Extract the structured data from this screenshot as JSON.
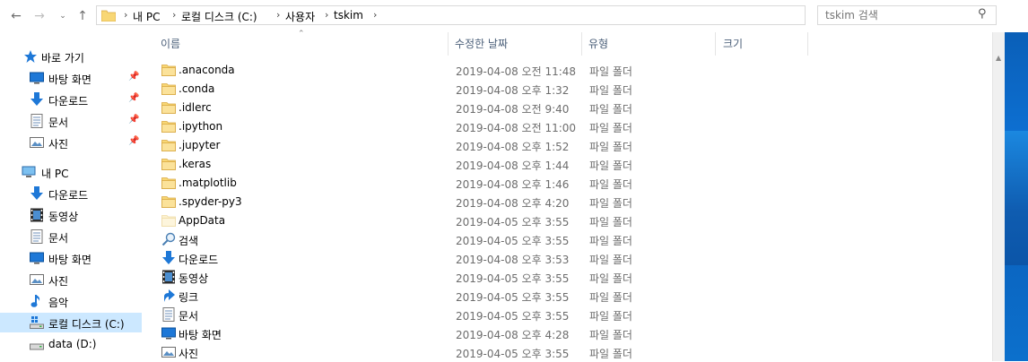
{
  "address": {
    "crumbs": [
      "내 PC",
      "로컬 디스크 (C:)",
      "사용자",
      "tskim"
    ],
    "search_placeholder": "tskim 검색"
  },
  "columns": {
    "name": "이름",
    "date": "수정한 날짜",
    "type": "유형",
    "size": "크기"
  },
  "nav": {
    "quick_access": "바로 가기",
    "quick_items": [
      {
        "label": "바탕 화면",
        "icon": "desktop-icon"
      },
      {
        "label": "다운로드",
        "icon": "download-icon"
      },
      {
        "label": "문서",
        "icon": "document-icon"
      },
      {
        "label": "사진",
        "icon": "picture-icon"
      }
    ],
    "this_pc": "내 PC",
    "pc_items": [
      {
        "label": "다운로드",
        "icon": "download-icon"
      },
      {
        "label": "동영상",
        "icon": "video-icon"
      },
      {
        "label": "문서",
        "icon": "document-icon"
      },
      {
        "label": "바탕 화면",
        "icon": "desktop-icon"
      },
      {
        "label": "사진",
        "icon": "picture-icon"
      },
      {
        "label": "음악",
        "icon": "music-icon"
      },
      {
        "label": "로컬 디스크 (C:)",
        "icon": "local-disk-icon"
      },
      {
        "label": "data (D:)",
        "icon": "drive-icon"
      }
    ]
  },
  "files": [
    {
      "name": ".anaconda",
      "date": "2019-04-08 오전 11:48",
      "type": "파일 폴더",
      "icon": "folder-icon"
    },
    {
      "name": ".conda",
      "date": "2019-04-08 오후 1:32",
      "type": "파일 폴더",
      "icon": "folder-icon"
    },
    {
      "name": ".idlerc",
      "date": "2019-04-08 오전 9:40",
      "type": "파일 폴더",
      "icon": "folder-icon"
    },
    {
      "name": ".ipython",
      "date": "2019-04-08 오전 11:00",
      "type": "파일 폴더",
      "icon": "folder-icon"
    },
    {
      "name": ".jupyter",
      "date": "2019-04-08 오후 1:52",
      "type": "파일 폴더",
      "icon": "folder-icon"
    },
    {
      "name": ".keras",
      "date": "2019-04-08 오후 1:44",
      "type": "파일 폴더",
      "icon": "folder-icon"
    },
    {
      "name": ".matplotlib",
      "date": "2019-04-08 오후 1:46",
      "type": "파일 폴더",
      "icon": "folder-icon"
    },
    {
      "name": ".spyder-py3",
      "date": "2019-04-08 오후 4:20",
      "type": "파일 폴더",
      "icon": "folder-icon"
    },
    {
      "name": "AppData",
      "date": "2019-04-05 오후 3:55",
      "type": "파일 폴더",
      "icon": "hidden-folder-icon"
    },
    {
      "name": "검색",
      "date": "2019-04-05 오후 3:55",
      "type": "파일 폴더",
      "icon": "search-icon"
    },
    {
      "name": "다운로드",
      "date": "2019-04-08 오후 3:53",
      "type": "파일 폴더",
      "icon": "download-icon"
    },
    {
      "name": "동영상",
      "date": "2019-04-05 오후 3:55",
      "type": "파일 폴더",
      "icon": "video-icon"
    },
    {
      "name": "링크",
      "date": "2019-04-05 오후 3:55",
      "type": "파일 폴더",
      "icon": "link-icon"
    },
    {
      "name": "문서",
      "date": "2019-04-05 오후 3:55",
      "type": "파일 폴더",
      "icon": "document-icon"
    },
    {
      "name": "바탕 화면",
      "date": "2019-04-08 오후 4:28",
      "type": "파일 폴더",
      "icon": "desktop-icon"
    },
    {
      "name": "사진",
      "date": "2019-04-05 오후 3:55",
      "type": "파일 폴더",
      "icon": "picture-icon"
    }
  ],
  "colors": {
    "accent_blue": "#1e78d7",
    "folder_yellow": "#f8d775",
    "selected_bg": "#cce8ff",
    "header_text": "#4c607a",
    "secondary_text": "#6d6d6d"
  }
}
